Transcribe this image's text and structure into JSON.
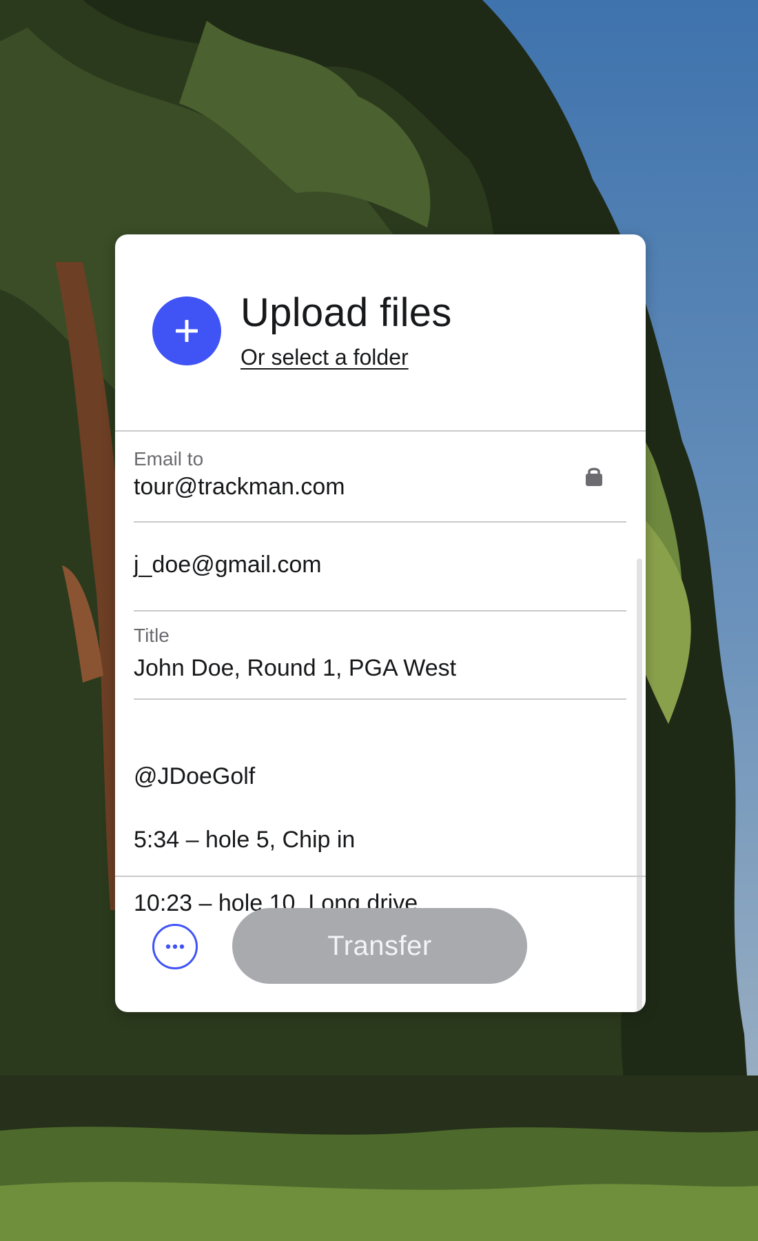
{
  "upload": {
    "title": "Upload files",
    "folder_link": "Or select a folder",
    "add_icon": "plus-icon"
  },
  "form": {
    "email_to": {
      "label": "Email to",
      "value": "tour@trackman.com",
      "icon": "lock-icon"
    },
    "your_email": {
      "value": "j_doe@gmail.com"
    },
    "title": {
      "label": "Title",
      "value": "John Doe, Round 1, PGA West"
    },
    "message": {
      "lines": [
        "@JDoeGolf",
        "5:34 – hole 5, Chip in",
        "10:23 – hole 10, Long drive"
      ]
    }
  },
  "actions": {
    "more_icon": "more-options-icon",
    "transfer_label": "Transfer"
  },
  "colors": {
    "accent": "#4053f5",
    "disabled_button": "#a9aaae"
  }
}
